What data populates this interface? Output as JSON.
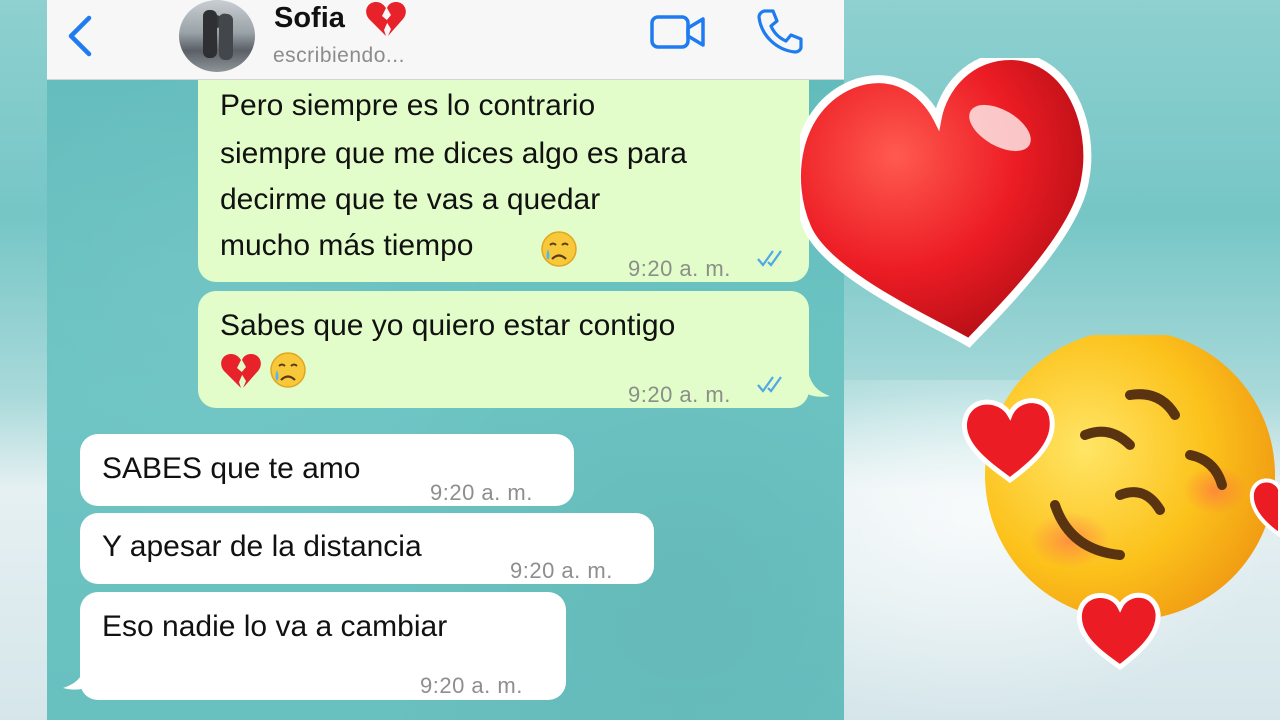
{
  "header": {
    "contact_name": "Sofia",
    "status": "escribiendo...",
    "name_emoji": "broken-heart-icon"
  },
  "messages": [
    {
      "direction": "out",
      "lines": [
        "Pero siempre es lo contrario",
        "siempre que me dices algo es para",
        "decirme que te vas a quedar",
        "mucho más tiempo"
      ],
      "trailing_emoji": "crying-face-icon",
      "time": "9:20 a. m.",
      "read": true
    },
    {
      "direction": "out",
      "lines": [
        "Sabes que yo quiero estar contigo"
      ],
      "second_line_emojis": [
        "broken-heart-icon",
        "crying-face-icon"
      ],
      "time": "9:20 a. m.",
      "read": true
    },
    {
      "direction": "in",
      "lines": [
        "SABES que te amo"
      ],
      "time": "9:20 a. m."
    },
    {
      "direction": "in",
      "lines": [
        "Y apesar de la distancia"
      ],
      "time": "9:20 a. m."
    },
    {
      "direction": "in",
      "lines": [
        "Eso nadie lo va a cambiar"
      ],
      "time": "9:20 a. m."
    }
  ],
  "decorations": [
    "red-heart-icon",
    "smiling-face-with-hearts-icon"
  ],
  "colors": {
    "header_bg": "#f7f7f7",
    "chat_bg": "#6cc4c3",
    "outgoing_bubble": "#e2fdc9",
    "incoming_bubble": "#ffffff",
    "accent_blue": "#1e7cf0",
    "read_ticks": "#4fa8e6"
  }
}
